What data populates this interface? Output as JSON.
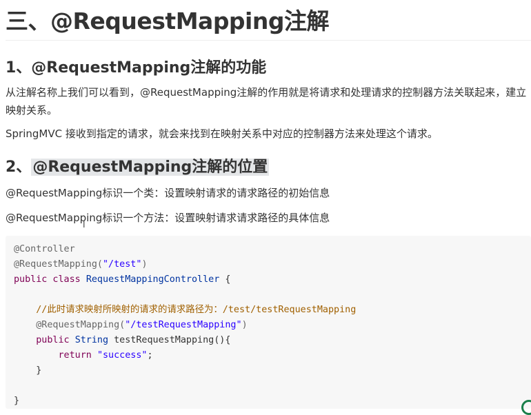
{
  "title": "三、@RequestMapping注解",
  "section1": {
    "heading": "1、@RequestMapping注解的功能",
    "para1": "从注解名称上我们可以看到，@RequestMapping注解的作用就是将请求和处理请求的控制器方法关联起来，建立映射关系。",
    "para2": "SpringMVC 接收到指定的请求，就会来找到在映射关系中对应的控制器方法来处理这个请求。"
  },
  "section2": {
    "heading_prefix": "2、",
    "heading_highlight": "@RequestMapping注解的位置",
    "para1": "@RequestMapping标识一个类：设置映射请求的请求路径的初始信息",
    "para2": "@RequestMapping标识一个方法：设置映射请求请求路径的具体信息"
  },
  "code": {
    "l1": "@Controller",
    "l2_ann": "@RequestMapping(",
    "l2_str": "\"/test\"",
    "l2_end": ")",
    "l3_kw": "public class ",
    "l3_type": "RequestMappingController",
    "l3_end": " {",
    "l5_comment": "    //此时请求映射所映射的请求的请求路径为：/test/testRequestMapping",
    "l6_ann": "    @RequestMapping(",
    "l6_str": "\"/testRequestMapping\"",
    "l6_end": ")",
    "l7_kw": "    public ",
    "l7_type": "String",
    "l7_end": " testRequestMapping(){",
    "l8_kw": "        return ",
    "l8_str": "\"success\"",
    "l8_end": ";",
    "l9": "    }",
    "l11": "}"
  },
  "colors": {
    "keyword": "#7f0055",
    "type": "#0033a0",
    "string": "#2a00ff",
    "comment": "#a06000"
  }
}
